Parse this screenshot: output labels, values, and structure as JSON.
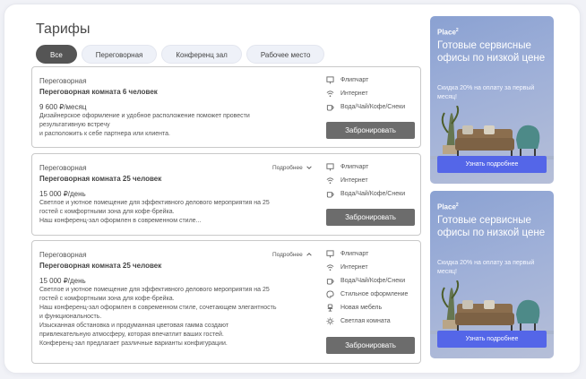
{
  "page": {
    "title": "Тарифы"
  },
  "filters": [
    {
      "label": "Все",
      "active": true
    },
    {
      "label": "Переговорная",
      "active": false
    },
    {
      "label": "Конференц зал",
      "active": false
    },
    {
      "label": "Рабочее место",
      "active": false
    }
  ],
  "cards": [
    {
      "type": "Переговорная",
      "name": "Переговорная комната 6 человек",
      "price": "9 600 ₽/месяц",
      "description": [
        "Дизайнерское оформление и удобное расположение поможет провести",
        "результативную встречу",
        "и расположить к себе партнера или клиента."
      ],
      "amenities": [
        "Флипчарт",
        "Интернет",
        "Вода/Чай/Кофе/Снеки"
      ],
      "book_label": "Забронировать"
    },
    {
      "type": "Переговорная",
      "name": "Переговорная комната 25 человек",
      "price": "15 000 ₽/день",
      "more_label": "Подробнее",
      "description": [
        "Светлое и уютное помещение для эффективного делового мероприятия на 25",
        "гостей с комфортными зона для кофе-брейка.",
        "Наш конференц-зал оформлен в современном стиле..."
      ],
      "amenities": [
        "Флипчарт",
        "Интернет",
        "Вода/Чай/Кофе/Снеки"
      ],
      "book_label": "Забронировать"
    },
    {
      "type": "Переговорная",
      "name": "Переговорная комната 25 человек",
      "price": "15 000 ₽/день",
      "more_label": "Подробнее",
      "description": [
        "Светлое и уютное помещение для эффективного делового мероприятия на 25",
        "гостей с комфортными зона для кофе-брейка.",
        "Наш конференц-зал оформлен в современном стиле, сочетающем элегантность",
        "и функциональность.",
        "Изысканная обстановка и продуманная цветовая гамма создают",
        "привлекательную атмосферу, которая впечатлит ваших гостей.",
        "Конференц-зал предлагает различные варианты конфигурации."
      ],
      "amenities": [
        "Флипчарт",
        "Интернет",
        "Вода/Чай/Кофе/Снеки",
        "Стильное оформление",
        "Новая мебель",
        "Светлая комната"
      ],
      "book_label": "Забронировать"
    }
  ],
  "ads": [
    {
      "brand": "Place",
      "brand_sup": "2",
      "headline": "Готовые сервисные офисы по низкой цене",
      "subtext": "Скидка 20% на оплату за первый месяц!",
      "cta": "Узнать подробнее"
    },
    {
      "brand": "Place",
      "brand_sup": "2",
      "headline": "Готовые сервисные офисы по низкой цене",
      "subtext": "Скидка 20% на оплату за первый месяц!",
      "cta": "Узнать подробнее"
    }
  ],
  "colors": {
    "accent_button": "#5466e8",
    "book_button": "#6c6c6c",
    "active_chip": "#555555"
  }
}
